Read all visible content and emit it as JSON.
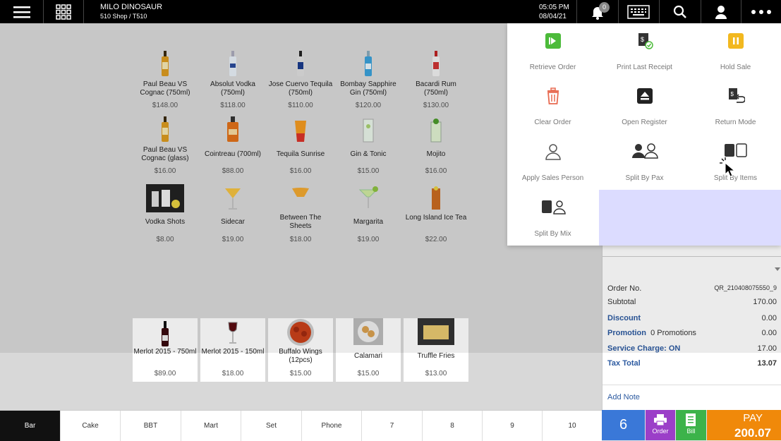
{
  "header": {
    "user_name": "MILO DINOSAUR",
    "shop": "510 Shop / T510",
    "time": "05:05 PM",
    "date": "08/04/21",
    "notification_count": "0"
  },
  "products_top": [
    {
      "name": "Paul Beau VS Cognac (750ml)",
      "price": "$148.00"
    },
    {
      "name": "Absolut Vodka (750ml)",
      "price": "$118.00"
    },
    {
      "name": "Jose Cuervo Tequila (750ml)",
      "price": "$110.00"
    },
    {
      "name": "Bombay Sapphire Gin (750ml)",
      "price": "$120.00"
    },
    {
      "name": "Bacardi Rum (750ml)",
      "price": "$130.00"
    },
    {
      "name": "Paul Beau VS Cognac (glass)",
      "price": "$16.00"
    },
    {
      "name": "Cointreau (700ml)",
      "price": "$88.00"
    },
    {
      "name": "Tequila Sunrise",
      "price": "$16.00"
    },
    {
      "name": "Gin & Tonic",
      "price": "$15.00"
    },
    {
      "name": "Mojito",
      "price": "$16.00"
    },
    {
      "name": "Vodka Shots",
      "price": "$8.00"
    },
    {
      "name": "Sidecar",
      "price": "$19.00"
    },
    {
      "name": "Between The Sheets",
      "price": "$18.00"
    },
    {
      "name": "Margarita",
      "price": "$19.00"
    },
    {
      "name": "Long Island Ice Tea",
      "price": "$22.00"
    }
  ],
  "products_bottom": [
    {
      "name": "Merlot 2015 - 750ml",
      "price": "$89.00"
    },
    {
      "name": "Merlot 2015 - 150ml",
      "price": "$18.00"
    },
    {
      "name": "Buffalo Wings (12pcs)",
      "price": "$15.00"
    },
    {
      "name": "Calamari",
      "price": "$15.00"
    },
    {
      "name": "Truffle Fries",
      "price": "$13.00"
    }
  ],
  "menu": {
    "items": [
      {
        "label": "Retrieve Order"
      },
      {
        "label": "Print Last Receipt"
      },
      {
        "label": "Hold Sale"
      },
      {
        "label": "Clear Order"
      },
      {
        "label": "Open Register"
      },
      {
        "label": "Return Mode"
      },
      {
        "label": "Apply Sales Person"
      },
      {
        "label": "Split By Pax"
      },
      {
        "label": "Split By Items"
      },
      {
        "label": "Split By Mix"
      }
    ]
  },
  "order": {
    "order_no_label": "Order No.",
    "order_no": "QR_210408075550_9",
    "subtotal_label": "Subtotal",
    "subtotal": "170.00",
    "discount_label": "Discount",
    "discount": "0.00",
    "promotion_label": "Promotion",
    "promotion_text": "0 Promotions",
    "promotion": "0.00",
    "service_label": "Service Charge: ON",
    "service": "17.00",
    "tax_label": "Tax Total",
    "tax": "13.07",
    "add_note": "Add Note"
  },
  "categories": [
    "Bar",
    "Cake",
    "BBT",
    "Mart",
    "Set",
    "Phone",
    "7",
    "8",
    "9",
    "10"
  ],
  "actions": {
    "pax": "6",
    "order_label": "Order",
    "bill_label": "Bill",
    "pay_label": "PAY",
    "pay_amount": "200.07"
  },
  "colors": {
    "topbar": "#000000",
    "pax_button": "#3a78d8",
    "order_button": "#9b3fc8",
    "bill_button": "#3cb34a",
    "pay_button": "#f0890a",
    "blue_label": "#2c5aa0"
  }
}
